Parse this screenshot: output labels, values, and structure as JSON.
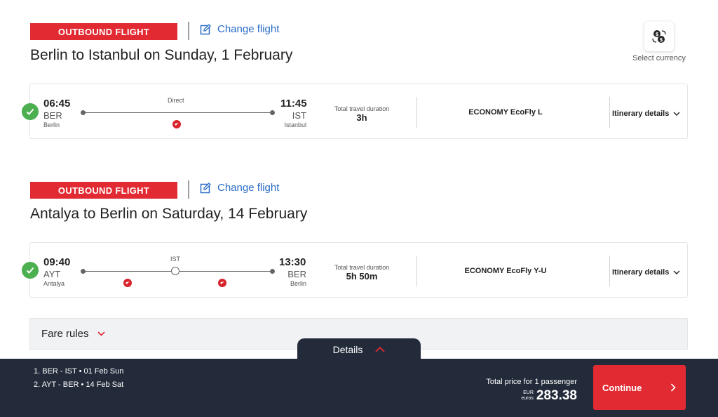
{
  "currency": {
    "label": "Select currency",
    "icon": "currency-exchange-icon"
  },
  "flights": [
    {
      "badge": "OUTBOUND FLIGHT",
      "change_label": "Change flight",
      "title": "Berlin to Istanbul on Sunday, 1 February",
      "dep_time": "06:45",
      "dep_code": "BER",
      "dep_city": "Berlin",
      "arr_time": "11:45",
      "arr_code": "IST",
      "arr_city": "Istanbul",
      "stop_label": "Direct",
      "duration_label": "Total travel duration",
      "duration": "3h",
      "cabin": "ECONOMY EcoFly L",
      "itinerary_label": "Itinerary details"
    },
    {
      "badge": "OUTBOUND FLIGHT",
      "change_label": "Change flight",
      "title": "Antalya to Berlin on Saturday, 14 February",
      "dep_time": "09:40",
      "dep_code": "AYT",
      "dep_city": "Antalya",
      "arr_time": "13:30",
      "arr_code": "BER",
      "arr_city": "Berlin",
      "stop_label": "IST",
      "duration_label": "Total travel duration",
      "duration": "5h 50m",
      "cabin": "ECONOMY EcoFly Y-U",
      "itinerary_label": "Itinerary details"
    }
  ],
  "fare_rules": {
    "label": "Fare rules"
  },
  "footer": {
    "details_label": "Details",
    "summary": [
      "1.  BER  -  IST  •  01 Feb Sun",
      "2.  AYT  -  BER  •  14 Feb Sat"
    ],
    "price_label": "Total price for 1 passenger",
    "currency_code": "EUR",
    "currency_name": "euros",
    "price": "283.38",
    "continue_label": "Continue"
  },
  "colors": {
    "brand_red": "#e22a32",
    "link_blue": "#2a6bc6",
    "success_green": "#4caf50",
    "footer_bg": "#232b3a"
  }
}
